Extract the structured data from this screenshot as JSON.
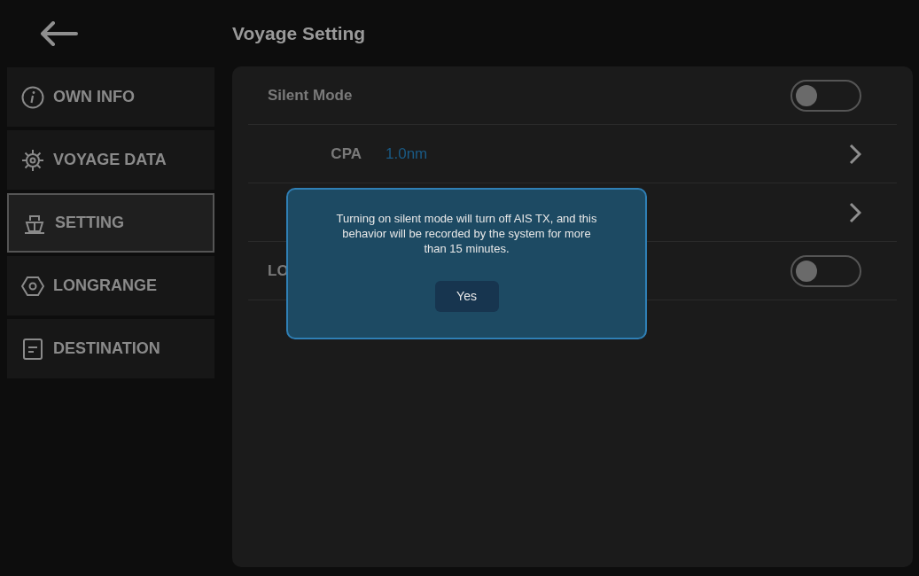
{
  "header": {
    "title": "Voyage Setting"
  },
  "sidebar": {
    "items": [
      {
        "kind": "info",
        "label": "OWN INFO",
        "selected": false
      },
      {
        "kind": "gear",
        "label": "VOYAGE DATA",
        "selected": false
      },
      {
        "kind": "ship",
        "label": "SETTING",
        "selected": true
      },
      {
        "kind": "hex",
        "label": "LONGRANGE",
        "selected": false
      },
      {
        "kind": "doc",
        "label": "DESTINATION",
        "selected": false
      }
    ]
  },
  "settings": [
    {
      "kind": "toggle",
      "label": "Silent Mode",
      "on": false
    },
    {
      "kind": "link",
      "label": "CPA",
      "value": "1.0nm"
    },
    {
      "kind": "link"
    },
    {
      "kind": "toggle",
      "label": "LO",
      "on": false
    }
  ],
  "dialog": {
    "message": "Turning on silent mode will turn off AIS TX, and this behavior will be recorded by the system for more than 15 minutes.",
    "button": "Yes"
  }
}
